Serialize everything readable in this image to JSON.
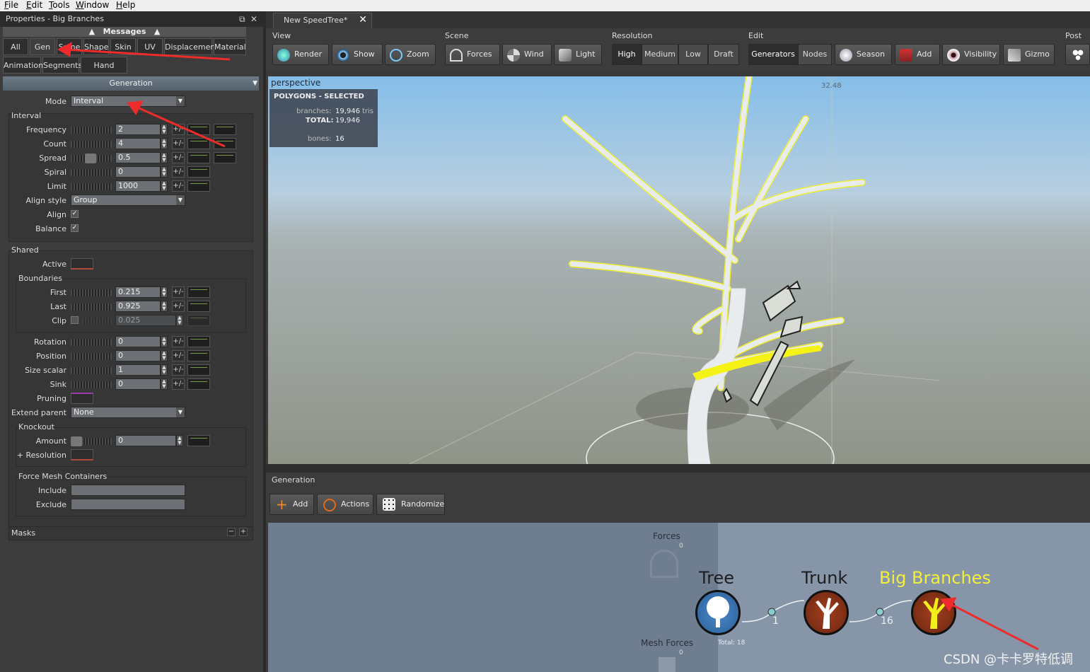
{
  "menu": {
    "items": [
      "File",
      "Edit",
      "Tools",
      "Window",
      "Help"
    ]
  },
  "left_panel": {
    "title": "Properties - Big Branches",
    "messages_label": "Messages",
    "tabs_row1": [
      "All",
      "Gen",
      "Spine",
      "Shape",
      "Skin",
      "UV",
      "Displacement",
      "Material"
    ],
    "tabs_row2": [
      "Animation",
      "Segments",
      "Hand Drawn"
    ],
    "active_tab": "Gen",
    "generation_header": "Generation",
    "mode": {
      "label": "Mode",
      "value": "Interval"
    },
    "interval": {
      "title": "Interval",
      "rows": [
        {
          "label": "Frequency",
          "value": "2",
          "pm": "+/-"
        },
        {
          "label": "Count",
          "value": "4",
          "pm": "+/-"
        },
        {
          "label": "Spread",
          "value": "0.5",
          "pm": "+/-"
        },
        {
          "label": "Spiral",
          "value": "0",
          "pm": "+/-"
        },
        {
          "label": "Limit",
          "value": "1000",
          "pm": "+/-"
        }
      ],
      "align_style": {
        "label": "Align style",
        "value": "Group"
      },
      "align": {
        "label": "Align"
      },
      "balance": {
        "label": "Balance"
      }
    },
    "shared": {
      "title": "Shared",
      "active_label": "Active",
      "boundaries": {
        "title": "Boundaries",
        "rows": [
          {
            "label": "First",
            "value": "0.215",
            "pm": "+/-"
          },
          {
            "label": "Last",
            "value": "0.925",
            "pm": "+/-"
          }
        ],
        "clip": {
          "label": "Clip",
          "value": "0.025"
        }
      },
      "rows": [
        {
          "label": "Rotation",
          "value": "0",
          "pm": "+/-"
        },
        {
          "label": "Position",
          "value": "0",
          "pm": "+/-"
        },
        {
          "label": "Size scalar",
          "value": "1",
          "pm": "+/-"
        },
        {
          "label": "Sink",
          "value": "0",
          "pm": "+/-"
        }
      ],
      "pruning_label": "Pruning",
      "extend_parent": {
        "label": "Extend parent",
        "value": "None"
      },
      "knockout": {
        "title": "Knockout",
        "amount_label": "Amount",
        "amount_value": "0",
        "resolution_label": "+ Resolution"
      },
      "force_mesh": {
        "title": "Force Mesh Containers",
        "include_label": "Include",
        "exclude_label": "Exclude"
      }
    },
    "masks_label": "Masks"
  },
  "view_tab": {
    "title": "New SpeedTree*"
  },
  "toolbar": {
    "sections": {
      "view": "View",
      "scene": "Scene",
      "resolution": "Resolution",
      "edit": "Edit",
      "post": "Post"
    },
    "view_buttons": [
      "Render",
      "Show",
      "Zoom"
    ],
    "scene_buttons": [
      "Forces",
      "Wind",
      "Light"
    ],
    "resolution_buttons": [
      "High",
      "Medium",
      "Low",
      "Draft"
    ],
    "resolution_active": "High",
    "edit_modes": [
      "Generators",
      "Nodes"
    ],
    "edit_active": "Generators",
    "edit_buttons": [
      "Season",
      "Add",
      "Visibility",
      "Gizmo"
    ]
  },
  "viewport": {
    "label": "perspective",
    "height_readout": "32.48",
    "stats": {
      "title": "POLYGONS - SELECTED",
      "branches_label": "branches:",
      "branches_value": "19,946",
      "branches_unit": "tris",
      "total_label": "TOTAL:",
      "total_value": "19,946",
      "bones_label": "bones:",
      "bones_value": "16"
    }
  },
  "generation_panel": {
    "title": "Generation",
    "buttons": [
      "Add",
      "Actions",
      "Randomize"
    ],
    "graph": {
      "forces_label": "Forces",
      "forces_count": "0",
      "mesh_forces_label": "Mesh Forces",
      "mesh_forces_count": "0",
      "total_label": "Total: 18",
      "nodes": [
        {
          "name": "Tree"
        },
        {
          "name": "Trunk"
        },
        {
          "name": "Big Branches"
        }
      ],
      "links": [
        "1",
        "16"
      ]
    }
  },
  "watermark": "CSDN @卡卡罗特低调"
}
